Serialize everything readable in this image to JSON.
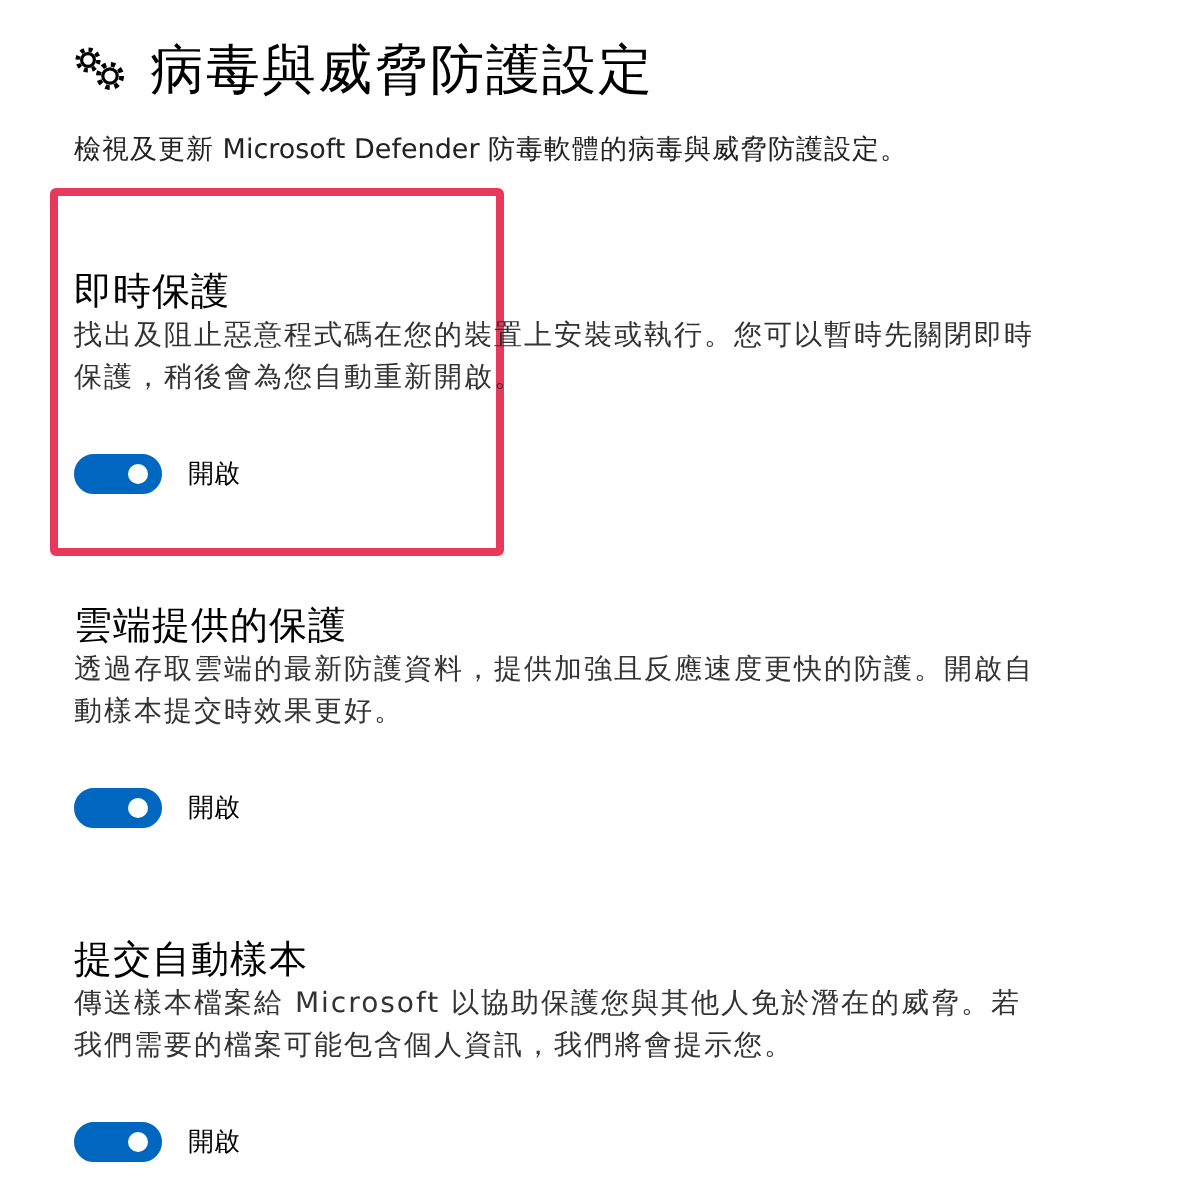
{
  "page": {
    "title": "病毒與威脅防護設定",
    "subtitle": "檢視及更新 Microsoft Defender 防毒軟體的病毒與威脅防護設定。"
  },
  "sections": [
    {
      "heading": "即時保護",
      "description": "找出及阻止惡意程式碼在您的裝置上安裝或執行。您可以暫時先關閉即時保護，稍後會為您自動重新開啟。",
      "on": true,
      "toggle_label": "開啟",
      "highlighted": true
    },
    {
      "heading": "雲端提供的保護",
      "description": "透過存取雲端的最新防護資料，提供加強且反應速度更快的防護。開啟自動樣本提交時效果更好。",
      "on": true,
      "toggle_label": "開啟",
      "highlighted": false
    },
    {
      "heading": "提交自動樣本",
      "description": "傳送樣本檔案給 Microsoft 以協助保護您與其他人免於潛在的威脅。若我們需要的檔案可能包含個人資訊，我們將會提示您。",
      "on": true,
      "toggle_label": "開啟",
      "highlighted": false
    }
  ]
}
